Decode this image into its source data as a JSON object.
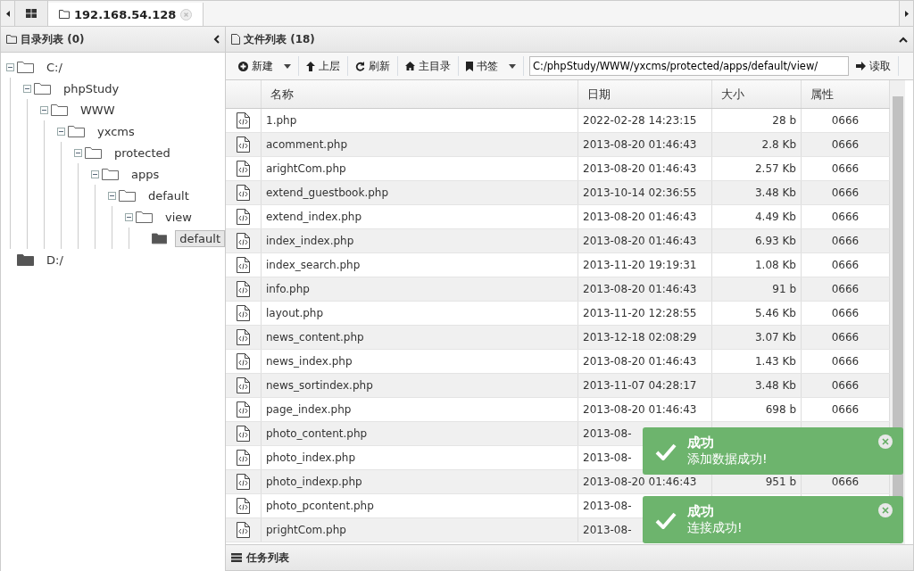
{
  "tabs": [
    {
      "kind": "home",
      "selected": false
    },
    {
      "kind": "folder",
      "label": "192.168.54.128",
      "selected": true
    }
  ],
  "tree_panel": {
    "title": "目录列表 (0)",
    "nodes": [
      {
        "label": "C:/",
        "expanded": true,
        "selected": false,
        "children": [
          {
            "label": "phpStudy",
            "expanded": true,
            "selected": false,
            "children": [
              {
                "label": "WWW",
                "expanded": true,
                "selected": false,
                "children": [
                  {
                    "label": "yxcms",
                    "expanded": true,
                    "selected": false,
                    "children": [
                      {
                        "label": "protected",
                        "expanded": true,
                        "selected": false,
                        "children": [
                          {
                            "label": "apps",
                            "expanded": true,
                            "selected": false,
                            "children": [
                              {
                                "label": "default",
                                "expanded": true,
                                "selected": false,
                                "children": [
                                  {
                                    "label": "view",
                                    "expanded": true,
                                    "selected": false,
                                    "children": [
                                      {
                                        "label": "default",
                                        "expanded": false,
                                        "selected": true
                                      }
                                    ]
                                  }
                                ]
                              }
                            ]
                          }
                        ]
                      }
                    ]
                  }
                ]
              }
            ]
          }
        ]
      },
      {
        "label": "D:/",
        "expanded": false,
        "selected": false
      }
    ]
  },
  "file_panel": {
    "title": "文件列表 (18)",
    "toolbar": [
      {
        "kind": "new",
        "label": "新建",
        "dropdown": true
      },
      {
        "kind": "up",
        "label": "上层",
        "dropdown": false
      },
      {
        "kind": "refresh",
        "label": "刷新",
        "dropdown": false
      },
      {
        "kind": "home",
        "label": "主目录",
        "dropdown": false
      },
      {
        "kind": "bookmark",
        "label": "书签",
        "dropdown": true
      }
    ],
    "path": "C:/phpStudy/WWW/yxcms/protected/apps/default/view/",
    "read_button": "读取",
    "columns": [
      "名称",
      "日期",
      "大小",
      "属性"
    ],
    "rows": [
      [
        "1.php",
        "2022-02-28 14:23:15",
        "28 b",
        "0666"
      ],
      [
        "acomment.php",
        "2013-08-20 01:46:43",
        "2.8 Kb",
        "0666"
      ],
      [
        "arightCom.php",
        "2013-08-20 01:46:43",
        "2.57 Kb",
        "0666"
      ],
      [
        "extend_guestbook.php",
        "2013-10-14 02:36:55",
        "3.48 Kb",
        "0666"
      ],
      [
        "extend_index.php",
        "2013-08-20 01:46:43",
        "4.49 Kb",
        "0666"
      ],
      [
        "index_index.php",
        "2013-08-20 01:46:43",
        "6.93 Kb",
        "0666"
      ],
      [
        "index_search.php",
        "2013-11-20 19:19:31",
        "1.08 Kb",
        "0666"
      ],
      [
        "info.php",
        "2013-08-20 01:46:43",
        "91 b",
        "0666"
      ],
      [
        "layout.php",
        "2013-11-20 12:28:55",
        "5.46 Kb",
        "0666"
      ],
      [
        "news_content.php",
        "2013-12-18 02:08:29",
        "3.07 Kb",
        "0666"
      ],
      [
        "news_index.php",
        "2013-08-20 01:46:43",
        "1.43 Kb",
        "0666"
      ],
      [
        "news_sortindex.php",
        "2013-11-07 04:28:17",
        "3.48 Kb",
        "0666"
      ],
      [
        "page_index.php",
        "2013-08-20 01:46:43",
        "698 b",
        "0666"
      ],
      [
        "photo_content.php",
        "2013-08-"
      ],
      [
        "photo_index.php",
        "2013-08-"
      ],
      [
        "photo_indexp.php",
        "2013-08-20 01:46:43",
        "951 b",
        "0666"
      ],
      [
        "photo_pcontent.php",
        "2013-08-"
      ],
      [
        "prightCom.php",
        "2013-08-"
      ]
    ]
  },
  "task_bar": {
    "title": "任务列表"
  },
  "toasts": [
    {
      "title": "成功",
      "message": "添加数据成功!"
    },
    {
      "title": "成功",
      "message": "连接成功!"
    }
  ]
}
